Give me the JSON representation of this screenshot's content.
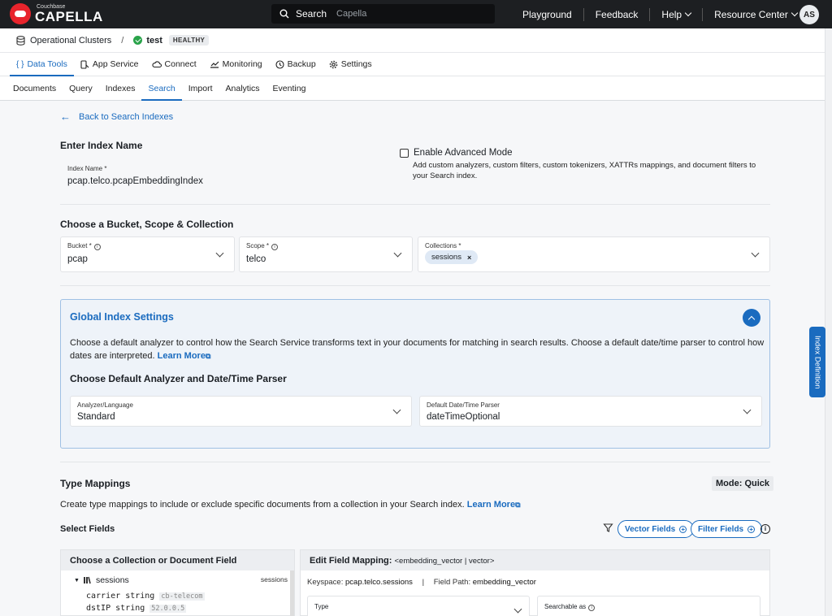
{
  "app": {
    "logo_sub": "Couchbase",
    "logo_main": "CAPELLA"
  },
  "search": {
    "label": "Search",
    "placeholder": "Capella"
  },
  "topnav": {
    "playground": "Playground",
    "feedback": "Feedback",
    "help": "Help",
    "resource_center": "Resource Center",
    "avatar": "AS"
  },
  "cluster": {
    "breadcrumb_root": "Operational Clusters",
    "separator": "/",
    "name": "test",
    "status": "HEALTHY"
  },
  "main_tabs": [
    {
      "label": "Data Tools",
      "icon": "{ }"
    },
    {
      "label": "App Service",
      "icon": "app-service-icon"
    },
    {
      "label": "Connect",
      "icon": "cloud-icon"
    },
    {
      "label": "Monitoring",
      "icon": "chart-icon"
    },
    {
      "label": "Backup",
      "icon": "clock-icon"
    },
    {
      "label": "Settings",
      "icon": "gear-icon"
    }
  ],
  "sub_tabs": [
    "Documents",
    "Query",
    "Indexes",
    "Search",
    "Import",
    "Analytics",
    "Eventing"
  ],
  "page": {
    "back_link": "Back to Search Indexes",
    "enter_index_name": "Enter Index Name",
    "index_name_label": "Index Name *",
    "index_name_value": "pcap.telco.pcapEmbeddingIndex",
    "advanced_mode_label": "Enable Advanced Mode",
    "advanced_mode_desc": "Add custom analyzers, custom filters, custom tokenizers, XATTRs mappings, and document filters to your Search index.",
    "bucket_section_title": "Choose a Bucket, Scope & Collection",
    "bucket_label": "Bucket *",
    "bucket_value": "pcap",
    "scope_label": "Scope *",
    "scope_value": "telco",
    "collections_label": "Collections *",
    "collection_chip": "sessions",
    "chip_remove": "×"
  },
  "global_settings": {
    "title": "Global Index Settings",
    "desc": "Choose a default analyzer to control how the Search Service transforms text in your documents for matching in search results. Choose a default date/time parser to control how dates are interpreted.",
    "learn_more": "Learn More",
    "subtitle": "Choose Default Analyzer and Date/Time Parser",
    "analyzer_label": "Analyzer/Language",
    "analyzer_value": "Standard",
    "parser_label": "Default Date/Time Parser",
    "parser_value": "dateTimeOptional"
  },
  "type_mappings": {
    "title": "Type Mappings",
    "mode": "Mode: Quick",
    "desc": "Create type mappings to include or exclude specific documents from a collection in your Search index.",
    "learn_more": "Learn More",
    "select_fields": "Select Fields",
    "vector_fields": "Vector Fields",
    "filter_fields": "Filter Fields"
  },
  "left_panel": {
    "header": "Choose a Collection or Document Field",
    "tree_collection": "sessions",
    "tree_right": "sessions",
    "fields": [
      {
        "name": "carrier",
        "type": "string",
        "sample": "cb-telecom"
      },
      {
        "name": "dstIP",
        "type": "string",
        "sample": "52.0.0.5"
      }
    ]
  },
  "right_panel": {
    "header": "Edit Field Mapping:",
    "header_field": "<embedding_vector | vector>",
    "keyspace_label": "Keyspace:",
    "keyspace_value": "pcap.telco.sessions",
    "meta_sep": "|",
    "field_path_label": "Field Path:",
    "field_path_value": "embedding_vector",
    "type_label": "Type",
    "searchable_label": "Searchable as"
  },
  "side_tab": "Index Definition",
  "colors": {
    "accent": "#1a6bbf",
    "topbar": "#1d1f22",
    "healthy": "#2aa34a",
    "brand_red": "#e8242c"
  }
}
